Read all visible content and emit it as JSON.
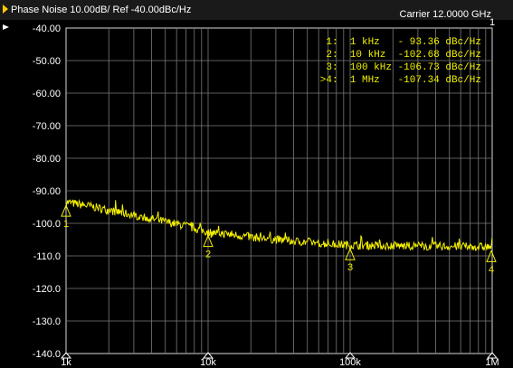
{
  "header": {
    "left": "Phase Noise 10.00dB/ Ref -40.00dBc/Hz",
    "right": "Carrier 12.0000 GHz",
    "channel_tag": "1"
  },
  "colors": {
    "background": "#000000",
    "frame": "#d8d8d8",
    "grid": "#7a7a7a",
    "trace": "#f4f000",
    "marker": "#f4f000",
    "text": "#ffffff",
    "title_bar": "#cfcfcf"
  },
  "chart_data": {
    "type": "line",
    "x_scale": "log",
    "x_unit": "Hz",
    "xlim": [
      1000,
      1000000
    ],
    "ylim": [
      -140,
      -40
    ],
    "yticks": [
      -40,
      -50,
      -60,
      -70,
      -80,
      -90,
      -100,
      -110,
      -120,
      -130,
      -140
    ],
    "ytick_labels": [
      "-40.00",
      "-50.00",
      "-60.00",
      "-70.00",
      "-80.00",
      "-90.00",
      "-100.0",
      "-110.0",
      "-120.0",
      "-130.0",
      "-140.0"
    ],
    "xtick_labels": [
      {
        "x": 1000,
        "label": "1k"
      },
      {
        "x": 10000,
        "label": "10k"
      },
      {
        "x": 100000,
        "label": "100k"
      },
      {
        "x": 1000000,
        "label": "1M"
      }
    ],
    "grid": true,
    "series": [
      {
        "points": [
          [
            1000,
            -93.5
          ],
          [
            1500,
            -94.8
          ],
          [
            2000,
            -96.0
          ],
          [
            3000,
            -97.5
          ],
          [
            5000,
            -99.5
          ],
          [
            7000,
            -100.8
          ],
          [
            10000,
            -102.7
          ],
          [
            15000,
            -103.5
          ],
          [
            20000,
            -104.2
          ],
          [
            30000,
            -105.0
          ],
          [
            50000,
            -105.8
          ],
          [
            70000,
            -106.3
          ],
          [
            100000,
            -106.7
          ],
          [
            200000,
            -106.9
          ],
          [
            300000,
            -107.0
          ],
          [
            500000,
            -107.1
          ],
          [
            700000,
            -107.2
          ],
          [
            1000000,
            -107.3
          ]
        ]
      }
    ],
    "markers": [
      {
        "id": "1",
        "x": 1000,
        "y": -93.36,
        "line": "1:  1 kHz   - 93.36 dBc/Hz"
      },
      {
        "id": "2",
        "x": 10000,
        "y": -102.68,
        "line": "2:  10 kHz  -102.68 dBc/Hz"
      },
      {
        "id": "3",
        "x": 100000,
        "y": -106.73,
        "line": "3:  100 kHz -106.73 dBc/Hz"
      },
      {
        "id": "4",
        "x": 1000000,
        "y": -107.34,
        "line": ">4:  1 MHz   -107.34 dBc/Hz"
      }
    ]
  }
}
